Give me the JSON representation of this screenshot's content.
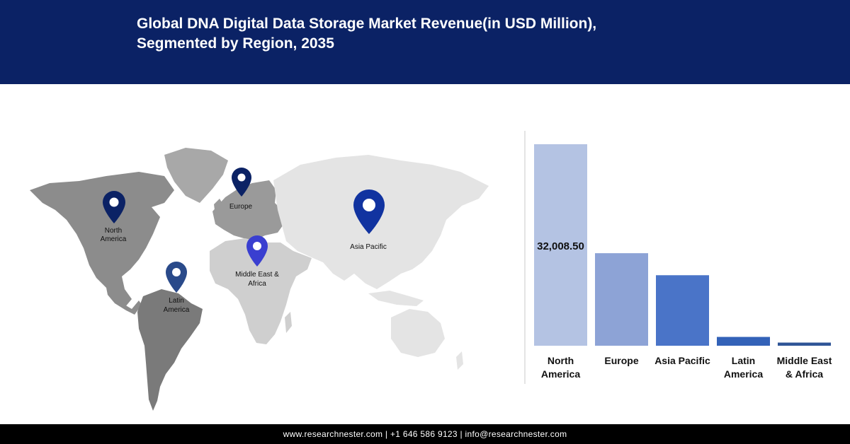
{
  "header": {
    "title_line1": "Global DNA Digital Data Storage Market Revenue(in USD Million),",
    "title_line2": "Segmented by Region, 2035"
  },
  "map": {
    "pins": [
      {
        "name": "north-america",
        "label_lines": [
          "North",
          "America"
        ],
        "color": "#0b2265",
        "icon": "map-pin-icon"
      },
      {
        "name": "europe",
        "label_lines": [
          "Europe"
        ],
        "color": "#0b2265",
        "icon": "map-pin-icon"
      },
      {
        "name": "asia-pacific",
        "label_lines": [
          "Asia Pacific"
        ],
        "color": "#1133a0",
        "icon": "map-pin-icon"
      },
      {
        "name": "middle-east-africa",
        "label_lines": [
          "Middle East &",
          "Africa"
        ],
        "color": "#3a3fd0",
        "icon": "map-pin-icon"
      },
      {
        "name": "latin-america",
        "label_lines": [
          "Latin",
          "America"
        ],
        "color": "#2a4a8a",
        "icon": "map-pin-icon"
      }
    ]
  },
  "chart_data": {
    "type": "bar",
    "title": "Global DNA Digital Data Storage Market Revenue(in USD Million), Segmented by Region, 2035",
    "categories": [
      [
        "North",
        "America"
      ],
      [
        "Europe"
      ],
      [
        "Asia Pacific"
      ],
      [
        "Latin",
        "America"
      ],
      [
        "Middle East",
        "& Africa"
      ]
    ],
    "values": [
      32008.5,
      14700,
      11200,
      1400,
      500
    ],
    "data_labels": [
      "32,008.50",
      "",
      "",
      "",
      ""
    ],
    "colors": [
      "#b4c3e3",
      "#8da3d6",
      "#4a74c8",
      "#3362b8",
      "#2f5597"
    ],
    "ylim": [
      0,
      32008.5
    ],
    "grid": false,
    "legend": "none"
  },
  "footer": {
    "text": "www.researchnester.com  | +1 646 586 9123 | info@researchnester.com"
  }
}
